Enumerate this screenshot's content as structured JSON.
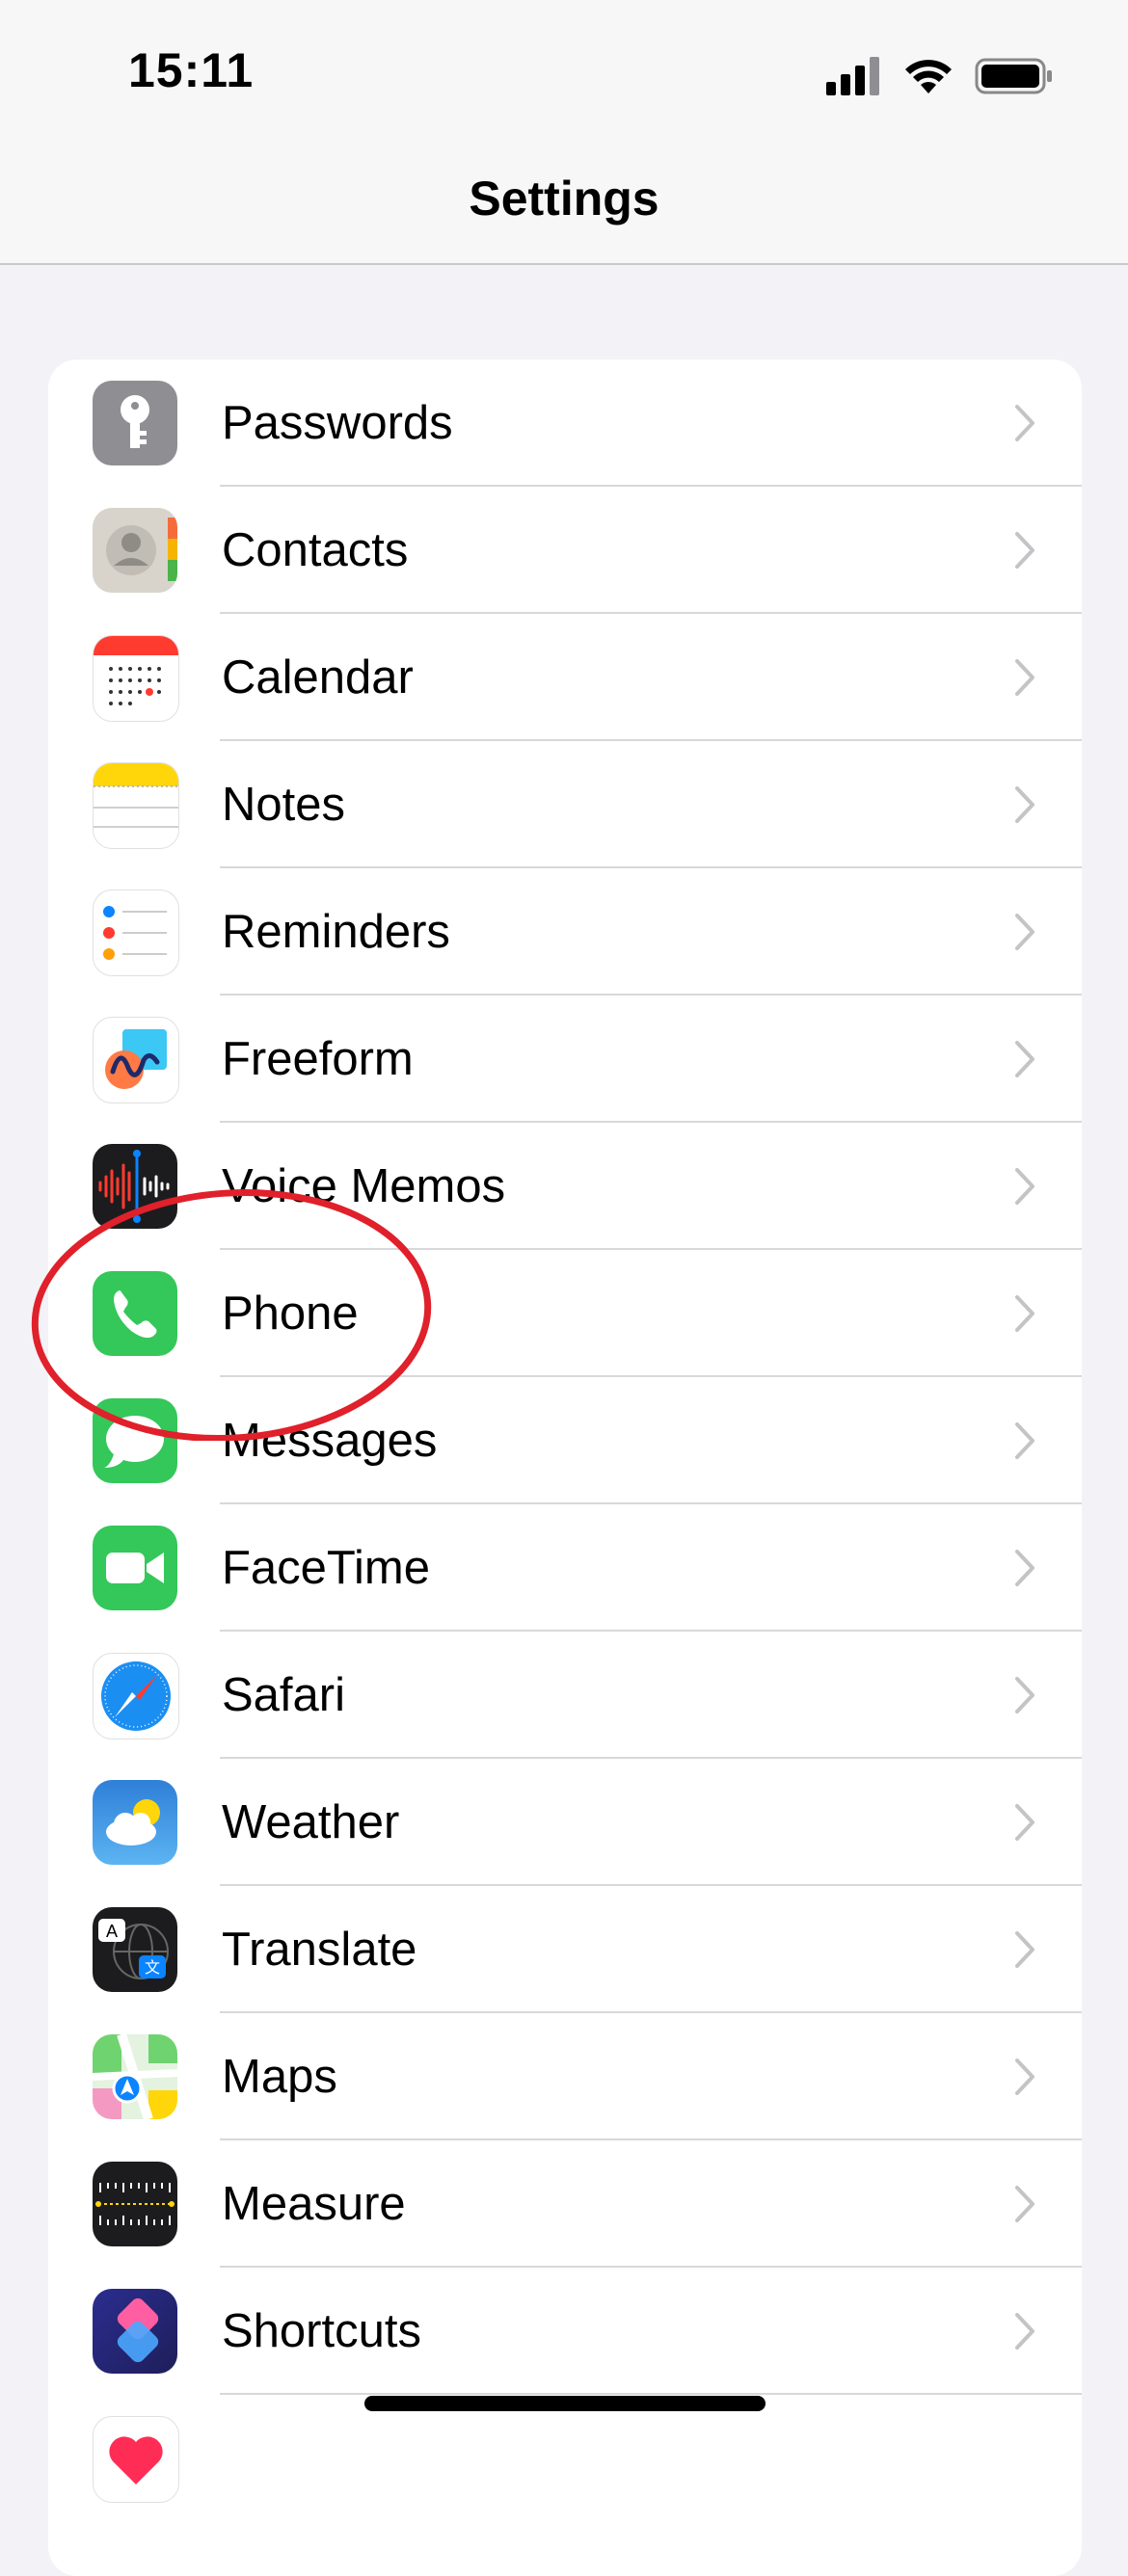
{
  "status_bar": {
    "time": "15:11"
  },
  "nav": {
    "title": "Settings"
  },
  "rows": [
    {
      "label": "Passwords"
    },
    {
      "label": "Contacts"
    },
    {
      "label": "Calendar"
    },
    {
      "label": "Notes"
    },
    {
      "label": "Reminders"
    },
    {
      "label": "Freeform"
    },
    {
      "label": "Voice Memos"
    },
    {
      "label": "Phone"
    },
    {
      "label": "Messages"
    },
    {
      "label": "FaceTime"
    },
    {
      "label": "Safari"
    },
    {
      "label": "Weather"
    },
    {
      "label": "Translate"
    },
    {
      "label": "Maps"
    },
    {
      "label": "Measure"
    },
    {
      "label": "Shortcuts"
    },
    {
      "label": ""
    }
  ],
  "colors": {
    "accent_annotation": "#e0202a",
    "chevron": "#c4c4c7"
  }
}
